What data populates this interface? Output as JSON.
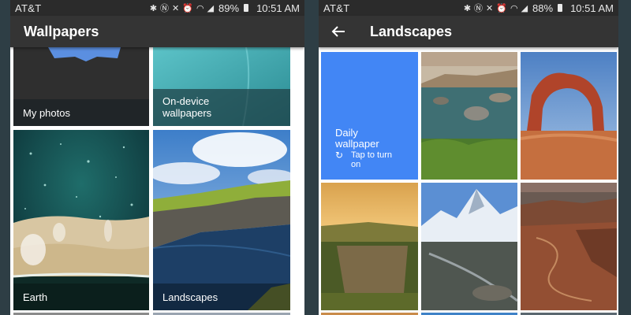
{
  "left_phone": {
    "status": {
      "carrier": "AT&T",
      "battery": "89%",
      "time": "10:51 AM"
    },
    "appbar": {
      "title": "Wallpapers"
    },
    "tiles": [
      {
        "label": "My photos"
      },
      {
        "label_line1": "On-device",
        "label_line2": "wallpapers"
      },
      {
        "label": "Earth"
      },
      {
        "label": "Landscapes"
      }
    ]
  },
  "right_phone": {
    "status": {
      "carrier": "AT&T",
      "battery": "88%",
      "time": "10:51 AM"
    },
    "appbar": {
      "title": "Landscapes",
      "back_icon": "arrow-back-icon"
    },
    "daily": {
      "title_line1": "Daily",
      "title_line2": "wallpaper",
      "sub_line1": "Tap to turn",
      "sub_line2": "on"
    }
  },
  "colors": {
    "accent": "#4286f5",
    "appbar": "#343434",
    "statusbar": "#2b2b2b"
  }
}
